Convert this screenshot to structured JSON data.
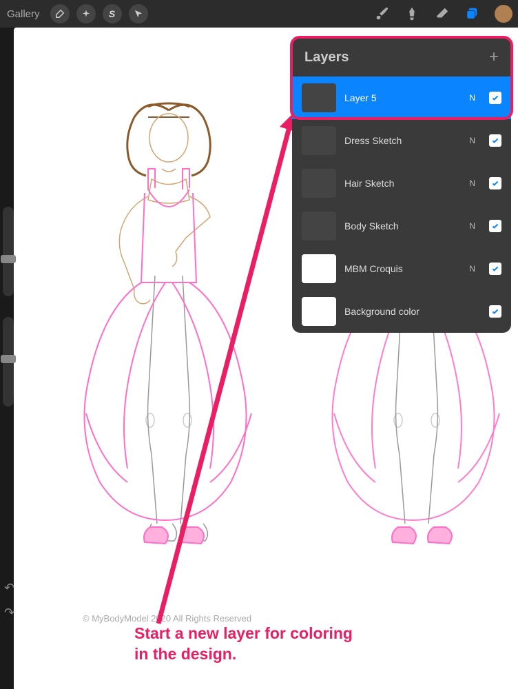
{
  "toolbar": {
    "gallery_label": "Gallery"
  },
  "layers_panel": {
    "title": "Layers",
    "items": [
      {
        "name": "Layer 5",
        "mode": "N",
        "checked": true,
        "selected": true,
        "thumb": "dark"
      },
      {
        "name": "Dress Sketch",
        "mode": "N",
        "checked": true,
        "selected": false,
        "thumb": "dark"
      },
      {
        "name": "Hair Sketch",
        "mode": "N",
        "checked": true,
        "selected": false,
        "thumb": "dark"
      },
      {
        "name": "Body Sketch",
        "mode": "N",
        "checked": true,
        "selected": false,
        "thumb": "dark"
      },
      {
        "name": "MBM Croquis",
        "mode": "N",
        "checked": true,
        "selected": false,
        "thumb": "white"
      },
      {
        "name": "Background color",
        "mode": "",
        "checked": true,
        "selected": false,
        "thumb": "white"
      }
    ]
  },
  "canvas": {
    "copyright": "© MyBodyModel 2020 All Rights Reserved"
  },
  "annotation": {
    "text_line1": "Start a new layer for coloring",
    "text_line2": "in the design."
  }
}
